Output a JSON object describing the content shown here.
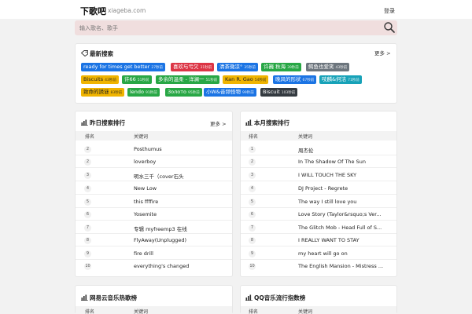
{
  "header": {
    "logo": "下歌吧",
    "domain": "xiageba.com",
    "login": "登录"
  },
  "search": {
    "placeholder": "输入歌名、歌手"
  },
  "latest": {
    "title": "最新搜索",
    "more": "更多 >",
    "tags": [
      {
        "text": "ready for times get better",
        "count": "27秒前",
        "color": "#1b74e4"
      },
      {
        "text": "喜欢与亏欠",
        "count": "31秒前",
        "color": "#dc3545"
      },
      {
        "text": "清茶微凉°",
        "count": "35秒前",
        "color": "#1b74e4"
      },
      {
        "text": "许巍 秋海",
        "count": "39秒前",
        "color": "#28a745"
      },
      {
        "text": "鳄鱼也爱笑",
        "count": "43秒前",
        "color": "#6c757d"
      },
      {
        "text": "Biscuits",
        "count": "43秒前",
        "color": "#f0b400"
      },
      {
        "text": "许66",
        "count": "51秒前",
        "color": "#28a745"
      },
      {
        "text": "多余的温柔 - 洋澜一",
        "count": "51秒前",
        "color": "#28a745"
      },
      {
        "text": "Kan R. Gao",
        "count": "54秒前",
        "color": "#f0b400"
      },
      {
        "text": "晚风的形状",
        "count": "67秒前",
        "color": "#1b74e4"
      },
      {
        "text": "吱麟&何洁",
        "count": "71秒前",
        "color": "#17a2b8"
      },
      {
        "text": "致命的誘谜",
        "count": "83秒前",
        "color": "#f0b400"
      },
      {
        "text": "lendo",
        "count": "91秒前",
        "color": "#28a745"
      },
      {
        "text": "Золото",
        "count": "95秒前",
        "color": "#28a745"
      },
      {
        "text": "小W&音频怪物",
        "count": "99秒前",
        "color": "#1b74e4"
      },
      {
        "text": "Biscuit",
        "count": "103秒前",
        "color": "#343a40"
      }
    ]
  },
  "yesterday": {
    "title": "昨日搜索排行",
    "more": "更多 >",
    "col_rank": "排名",
    "col_kw": "关键词",
    "rows": [
      {
        "rank": "2",
        "kw": "Posthumus"
      },
      {
        "rank": "2",
        "kw": "loverboy"
      },
      {
        "rank": "3",
        "kw": "明水三千（cover石头"
      },
      {
        "rank": "4",
        "kw": "New Low"
      },
      {
        "rank": "5",
        "kw": "this ffffire"
      },
      {
        "rank": "6",
        "kw": "Yosemite"
      },
      {
        "rank": "7",
        "kw": "专辑 myfreemp3 在线"
      },
      {
        "rank": "8",
        "kw": "FlyAway(Unplugged)"
      },
      {
        "rank": "9",
        "kw": "fire drill"
      },
      {
        "rank": "10",
        "kw": "everything's changed"
      }
    ]
  },
  "month": {
    "title": "本月搜索排行",
    "col_rank": "排名",
    "col_kw": "关键词",
    "rows": [
      {
        "rank": "1",
        "kw": "周杰伦"
      },
      {
        "rank": "2",
        "kw": "In The Shadow Of The Sun"
      },
      {
        "rank": "3",
        "kw": "I WILL TOUCH THE SKY"
      },
      {
        "rank": "4",
        "kw": "DJ Project - Regrete"
      },
      {
        "rank": "5",
        "kw": "The way I still love you"
      },
      {
        "rank": "6",
        "kw": "Love Story (Taylor&rsquo;s Ver..."
      },
      {
        "rank": "7",
        "kw": "The Glitch Mob - Head Full of S..."
      },
      {
        "rank": "8",
        "kw": "I REALLY WANT TO STAY"
      },
      {
        "rank": "9",
        "kw": "my heart will go on"
      },
      {
        "rank": "10",
        "kw": "The English Mansion - Mistress ..."
      }
    ]
  },
  "netease": {
    "title": "网易云音乐热歌榜",
    "col_rank": "排名",
    "col_kw": "关键词"
  },
  "qq": {
    "title": "QQ音乐流行指数榜",
    "col_rank": "排名",
    "col_kw": "关键词"
  }
}
